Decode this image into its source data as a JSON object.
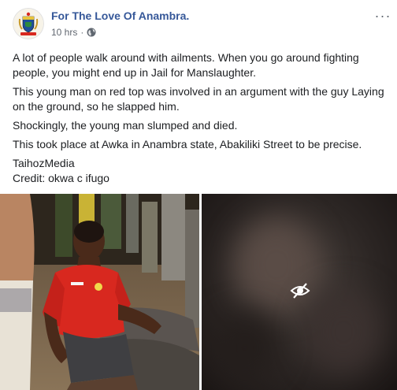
{
  "post": {
    "page_name": "For The Love Of Anambra.",
    "timestamp": "10 hrs",
    "separator": "·",
    "privacy_icon": "globe-icon",
    "options_icon": "more-options-icon",
    "options_glyph": "···",
    "paragraphs": [
      "A lot of people walk around with ailments. When you go around fighting people, you might end up in Jail for Manslaughter.",
      "This young man on red top was involved in an argument with the guy Laying on the ground, so he slapped him.",
      "Shockingly, the young man slumped and died.",
      "This took place at Awka in Anambra state, Abakiliki Street to be precise."
    ],
    "source": "TaihozMedia",
    "credit": "Credit: okwa c ifugo"
  },
  "media": {
    "photo_left": "street-scene-photo",
    "photo_right": "hidden-sensitive-photo",
    "hidden_icon": "eye-slash-icon"
  },
  "colors": {
    "page_name": "#365899",
    "meta": "#616770",
    "body_text": "#1c1e21",
    "shirt_red": "#d8281f"
  }
}
